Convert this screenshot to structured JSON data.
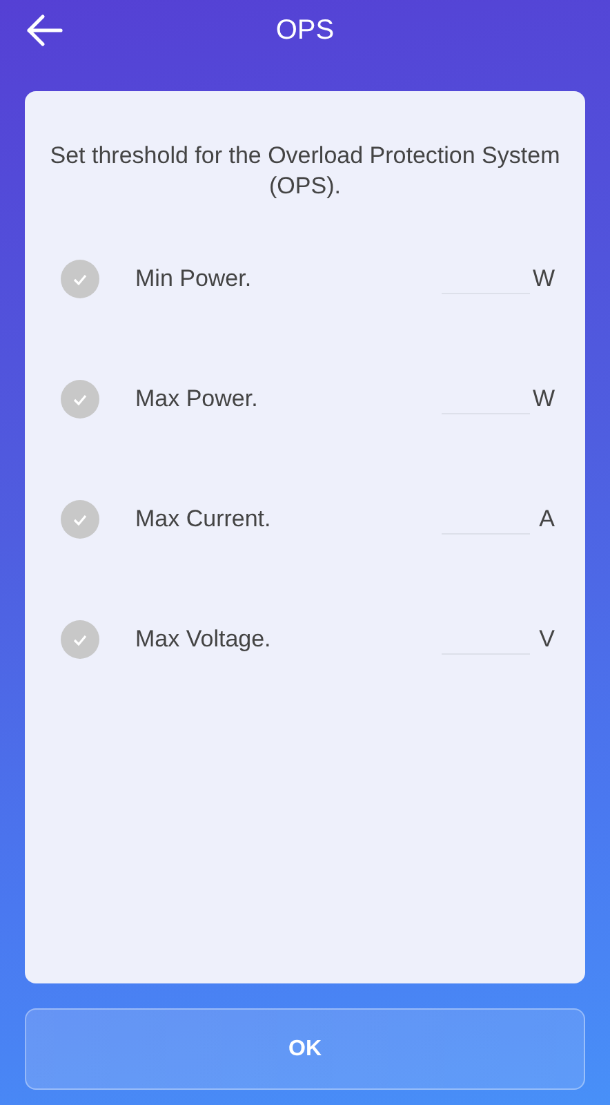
{
  "header": {
    "title": "OPS"
  },
  "description": "Set threshold for the Overload Protection System (OPS).",
  "thresholds": [
    {
      "label": "Min Power.",
      "unit": "W",
      "checked": false
    },
    {
      "label": "Max Power.",
      "unit": "W",
      "checked": false
    },
    {
      "label": "Max Current.",
      "unit": "A",
      "checked": false
    },
    {
      "label": "Max Voltage.",
      "unit": "V",
      "checked": false
    }
  ],
  "ok_button": "OK"
}
